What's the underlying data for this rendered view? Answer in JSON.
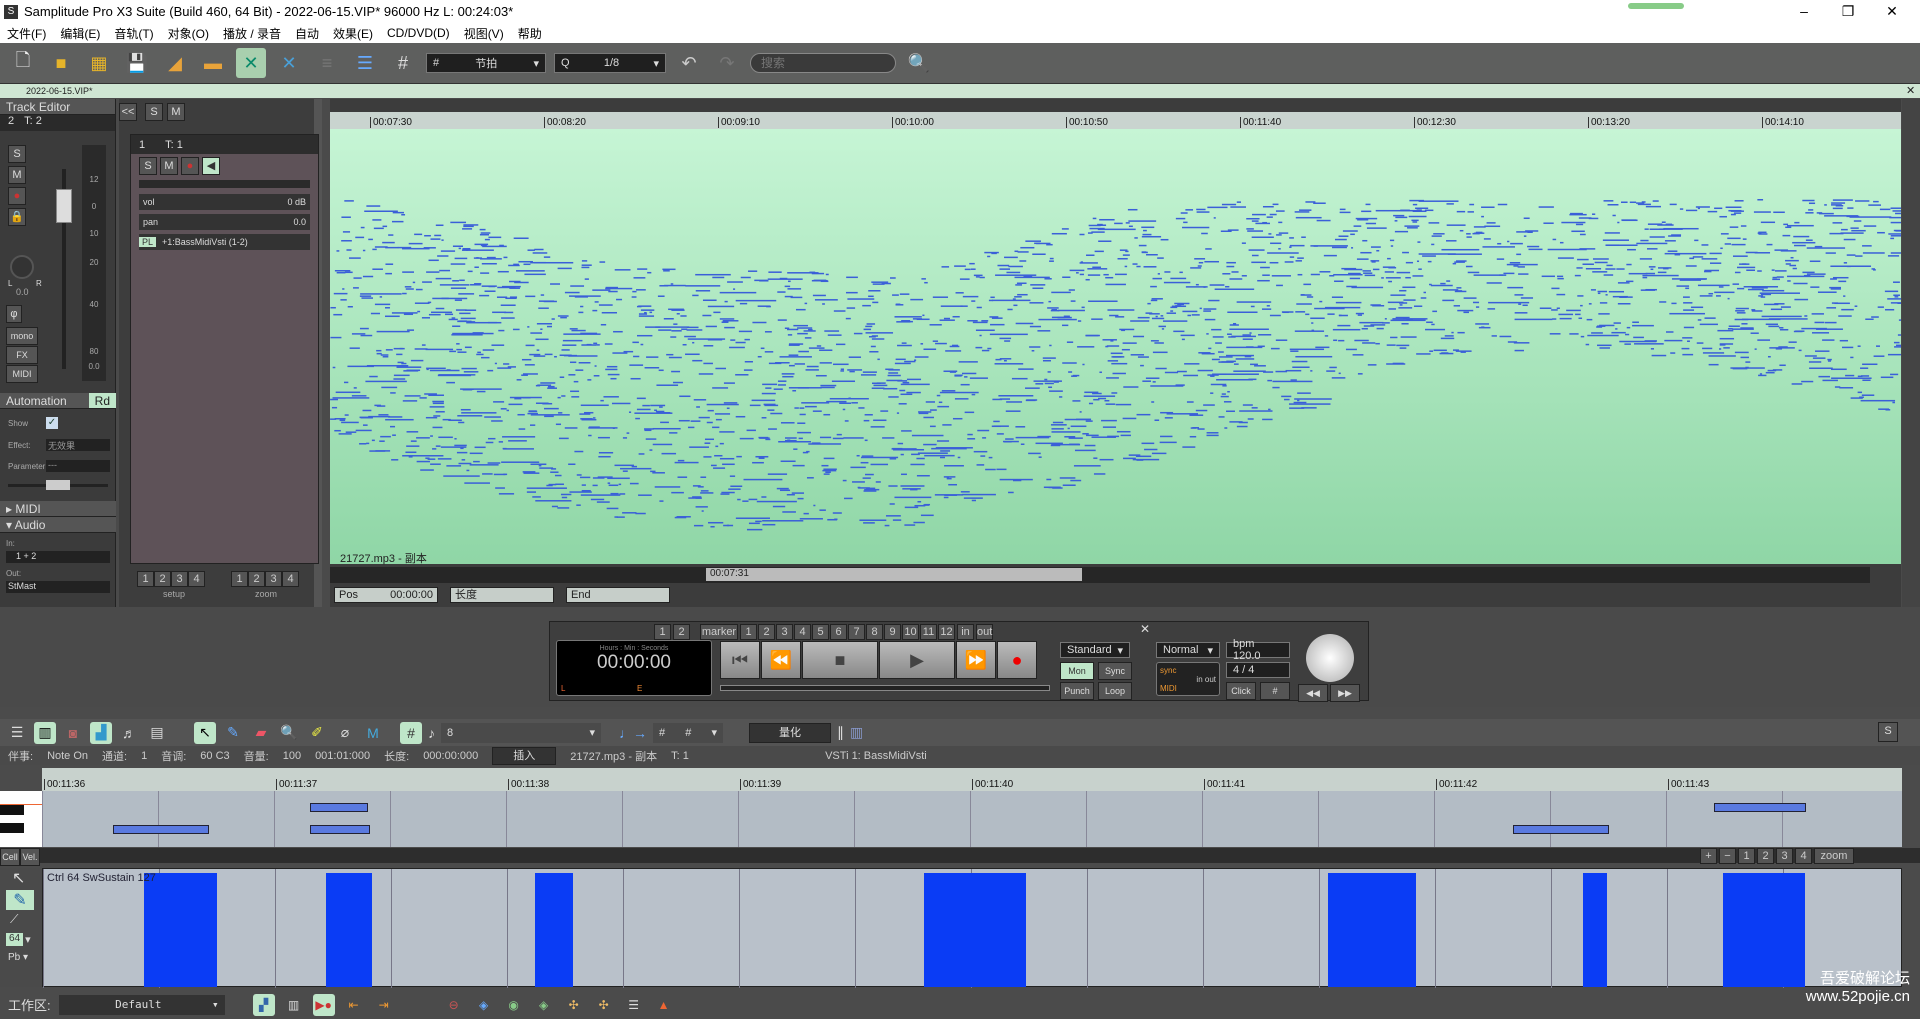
{
  "title": "Samplitude Pro X3 Suite (Build 460, 64 Bit)  -  2022-06-15.VIP*   96000 Hz L: 00:24:03*",
  "menu": [
    "文件(F)",
    "编辑(E)",
    "音轨(T)",
    "对象(O)",
    "播放 / 录音",
    "自动",
    "效果(E)",
    "CD/DVD(D)",
    "视图(V)",
    "帮助"
  ],
  "toolbar": {
    "snap_mode": "节拍",
    "quantize_label": "Q",
    "quantize_value": "1/8",
    "search_placeholder": "搜索"
  },
  "doc_tab": "2022-06-15.VIP*",
  "track_editor": {
    "header": "Track Editor",
    "track_num": "2",
    "track_name": "T: 2",
    "solo": "S",
    "mute": "M",
    "pan_value": "0.0",
    "pan_l": "L",
    "pan_r": "R",
    "mono": "mono",
    "fx": "FX",
    "midi": "MIDI",
    "meter_scale": [
      "12",
      "0",
      "10",
      "20",
      "40",
      "80"
    ],
    "meter_value": "0.0",
    "automation": {
      "header": "Automation",
      "rd": "Rd",
      "show_label": "Show",
      "show_checked": true,
      "effect_label": "Effect:",
      "effect_value": "无效果",
      "parameter_label": "Parameter",
      "parameter_value": "---"
    },
    "midi_section": "MIDI",
    "audio_section": "Audio",
    "in_label": "In:",
    "in_value": "1 + 2",
    "out_label": "Out:",
    "out_value": "StMast"
  },
  "track_list": {
    "collapse": "<<",
    "solo": "S",
    "mute": "M",
    "track_num": "1",
    "track_name": "T: 1",
    "vol_label": "vol",
    "vol_value": "0 dB",
    "pan_label": "pan",
    "pan_value": "0.0",
    "pl_label": "PL",
    "plugin": "+1:BassMidiVsti (1-2)",
    "setup_label": "setup",
    "zoom_label": "zoom",
    "presets": [
      "1",
      "2",
      "3",
      "4"
    ]
  },
  "arrange": {
    "ruler_ticks": [
      "00:07:30",
      "00:08:20",
      "00:09:10",
      "00:10:00",
      "00:10:50",
      "00:11:40",
      "00:12:30",
      "00:13:20",
      "00:14:10"
    ],
    "object_name": "21727.mp3 - 副本",
    "scroll_time": "00:07:31",
    "pos_label": "Pos",
    "pos_value": "00:00:00",
    "length_label": "长度",
    "end_label": "End"
  },
  "transport": {
    "marker_label": "marker",
    "markers": [
      "1",
      "2",
      "3",
      "4",
      "5",
      "6",
      "7",
      "8",
      "9",
      "10",
      "11",
      "12"
    ],
    "top_nums": [
      "1",
      "2"
    ],
    "in": "in",
    "out": "out",
    "display_format": "Hours : Min : Seconds",
    "time": "00:00:00",
    "l": "L",
    "e": "E",
    "mode": "Standard",
    "mon": "Mon",
    "sync": "Sync",
    "punch": "Punch",
    "loop": "Loop",
    "normal": "Normal",
    "bpm": "bpm 120.0",
    "sig": "4 / 4",
    "click": "Click",
    "sync_ind": "sync",
    "midi_ind": "MIDI",
    "inout": "in out"
  },
  "midi_editor": {
    "note_len": "8",
    "quantize_btn": "量化",
    "grid": "#",
    "event_label": "伴事:",
    "event_value": "Note On",
    "channel_label": "通道:",
    "channel_value": "1",
    "pitch_label": "音调:",
    "pitch_value": "60 C3",
    "velocity_label": "音量:",
    "velocity_value": "100",
    "position_value": "001:01:000",
    "length_label": "长度:",
    "length_value": "000:00:000",
    "insert_btn": "插入",
    "object": "21727.mp3 - 副本",
    "track": "T: 1",
    "instrument": "VSTi 1: BassMidiVsti",
    "ruler_ticks": [
      "00:11:36",
      "00:11:37",
      "00:11:38",
      "00:11:39",
      "00:11:40",
      "00:11:41",
      "00:11:42",
      "00:11:43"
    ],
    "cell": "Cell",
    "vel": "Vel.",
    "controller_label": "Ctrl 64 SwSustain 127",
    "ctrl_num": "64",
    "pb": "Pb",
    "zoom": "zoom",
    "zoom_presets": [
      "1",
      "2",
      "3",
      "4"
    ],
    "solo": "S"
  },
  "status": {
    "workspace_label": "工作区:",
    "workspace_value": "Default"
  },
  "watermark": [
    "吾爱破解论坛",
    "www.52pojie.cn"
  ],
  "colors": {
    "arrange_bg": "#b0e8c0",
    "note": "#3a5fd8",
    "controller": "#0a3cf5",
    "ctrl_bg": "#b9c1ca"
  }
}
